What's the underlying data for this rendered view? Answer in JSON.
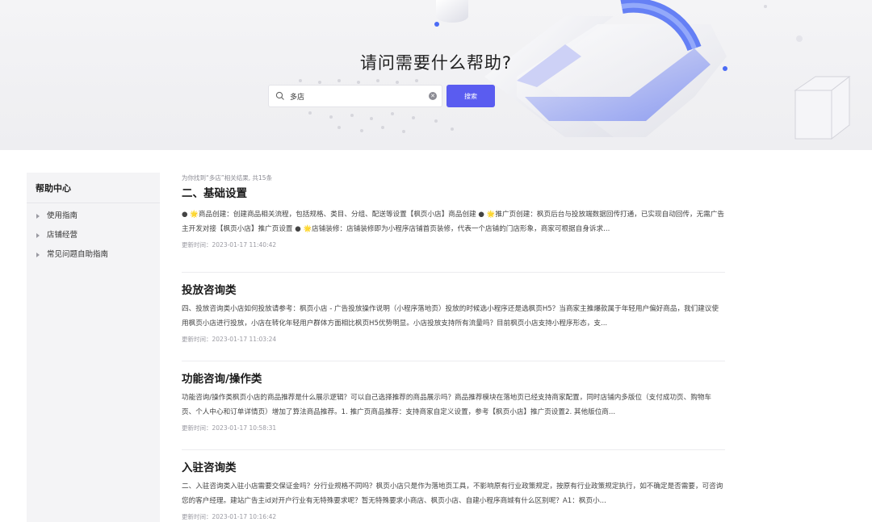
{
  "hero": {
    "title": "请问需要什么帮助?",
    "search": {
      "value": "多店",
      "placeholder": "",
      "button_label": "搜索"
    }
  },
  "sidebar": {
    "title": "帮助中心",
    "items": [
      {
        "label": "使用指南"
      },
      {
        "label": "店铺经营"
      },
      {
        "label": "常见问题自助指南"
      }
    ]
  },
  "results": {
    "summary": "为你找到“多店”相关结果, 共15条",
    "items": [
      {
        "title": "二、基础设置",
        "excerpt": "● 🌟商品创建：创建商品相关流程，包括规格、类目、分组、配送等设置【枫页小店】商品创建 ● 🌟推广页创建：枫页后台与投放端数据回传打通，已实现自动回传，无需广告主开发对接【枫页小店】推广页设置 ● 🌟店铺装修：店铺装修即为小程序店铺首页装修，代表一个店铺的门店形象，商家可根据自身诉求...",
        "time": "更新时间：2023-01-17 11:40:42"
      },
      {
        "title": "投放咨询类",
        "excerpt": "四、投放咨询类小店如何投放请参考：枫页小店 - 广告投放操作说明（小程序落地页）投放的时候选小程序还是选枫页H5？当商家主推爆款属于年轻用户偏好商品，我们建议使用枫页小店进行投放，小店在转化年轻用户群体方面相比枫页H5优势明显。小店投放支持所有流量吗？目前枫页小店支持小程序形态，支...",
        "time": "更新时间：2023-01-17 11:03:24"
      },
      {
        "title": "功能咨询/操作类",
        "excerpt": "功能咨询/操作类枫页小店的商品推荐是什么展示逻辑？可以自己选择推荐的商品展示吗？商品推荐模块在落地页已经支持商家配置，同时店铺内多版位（支付成功页、购物车页、个人中心和订单详情页）增加了算法商品推荐。1. 推广页商品推荐：支持商家自定义设置，参考【枫页小店】推广页设置2. 其他版位商...",
        "time": "更新时间：2023-01-17 10:58:31"
      },
      {
        "title": "入驻咨询类",
        "excerpt": "二、入驻咨询类入驻小店需要交保证金吗？分行业规格不同吗？枫页小店只是作为落地页工具，不影响原有行业政策规定，按原有行业政策规定执行，如不确定是否需要，可咨询您的客户经理。建站广告主id对开户行业有无特殊要求呢？暂无特殊要求小商店、枫页小店、自建小程序商城有什么区别呢？A1：枫页小...",
        "time": "更新时间：2023-01-17 10:16:42"
      }
    ]
  },
  "colors": {
    "accent": "#5a5cf0",
    "sidebar_bg": "#f4f4f6",
    "hero_bg": "#f1f1f4"
  }
}
